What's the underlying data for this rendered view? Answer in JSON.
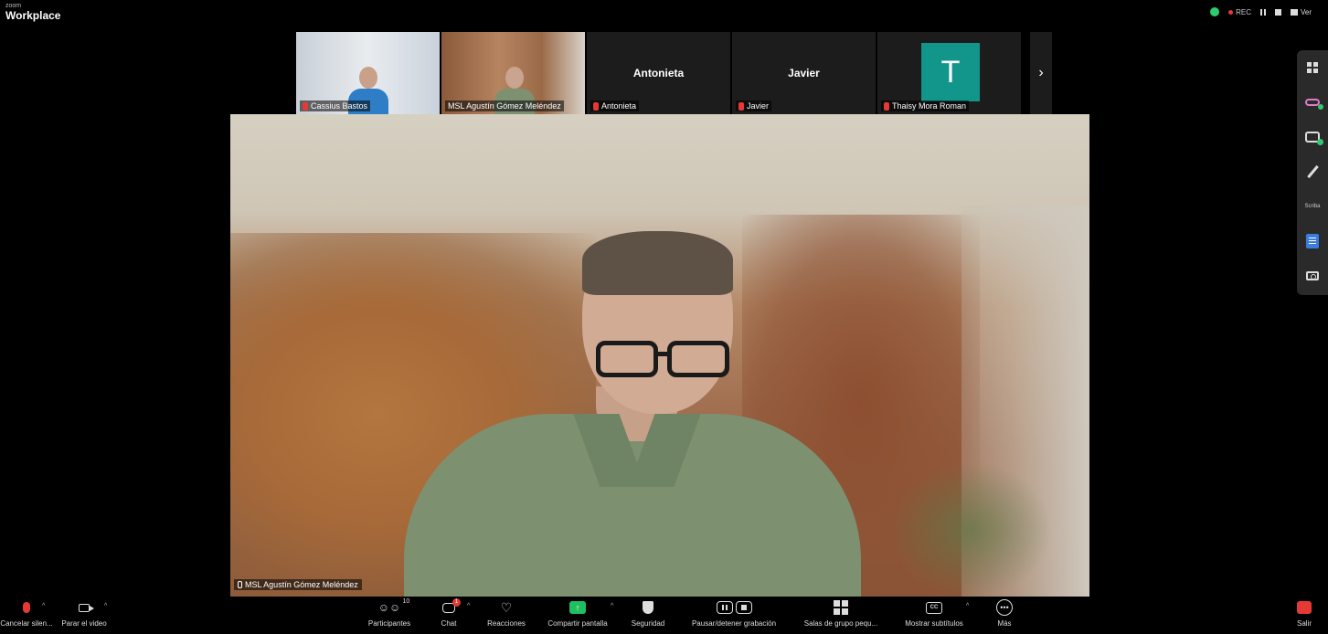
{
  "app": {
    "brand_small": "zoom",
    "brand_big": "Workplace"
  },
  "topbar": {
    "rec_label": "REC",
    "view_label": "Ver"
  },
  "thumbnails": [
    {
      "name": "Cassius Bastos",
      "type": "video",
      "mic_muted": true
    },
    {
      "name": "MSL Agustín Gómez Meléndez",
      "type": "video",
      "mic_muted": false,
      "active": true
    },
    {
      "name": "Antonieta",
      "center_name": "Antonieta",
      "type": "name",
      "mic_muted": true
    },
    {
      "name": "Javier",
      "center_name": "Javier",
      "type": "name",
      "mic_muted": true
    },
    {
      "name": "Thaisy Mora Roman",
      "avatar_letter": "T",
      "avatar_color": "#12958a",
      "type": "avatar",
      "mic_muted": true
    }
  ],
  "main_video": {
    "name": "MSL Agustín Gómez Meléndez"
  },
  "right_rail": [
    {
      "icon": "apps-grid-icon"
    },
    {
      "icon": "whiteboard-icon"
    },
    {
      "icon": "notes-icon"
    },
    {
      "icon": "annotate-icon"
    },
    {
      "label": "Scriba"
    },
    {
      "icon": "docs-icon"
    },
    {
      "icon": "camera-icon"
    }
  ],
  "toolbar": {
    "audio": "Cancelar silen...",
    "video": "Parar el video",
    "participants": "Participantes",
    "participants_count": "10",
    "chat": "Chat",
    "chat_badge": "1",
    "reactions": "Reacciones",
    "share": "Compartir pantalla",
    "security": "Seguridad",
    "record": "Pausar/detener grabación",
    "rooms": "Salas de grupo pequ...",
    "captions": "Mostrar subtítulos",
    "captions_badge": "CC",
    "more": "Más",
    "more_glyph": "•••",
    "leave": "Salir"
  },
  "colors": {
    "accent_green": "#1fbf5f",
    "alert_red": "#e53935",
    "avatar_teal": "#12958a",
    "active_outline": "#e8e3a8"
  }
}
